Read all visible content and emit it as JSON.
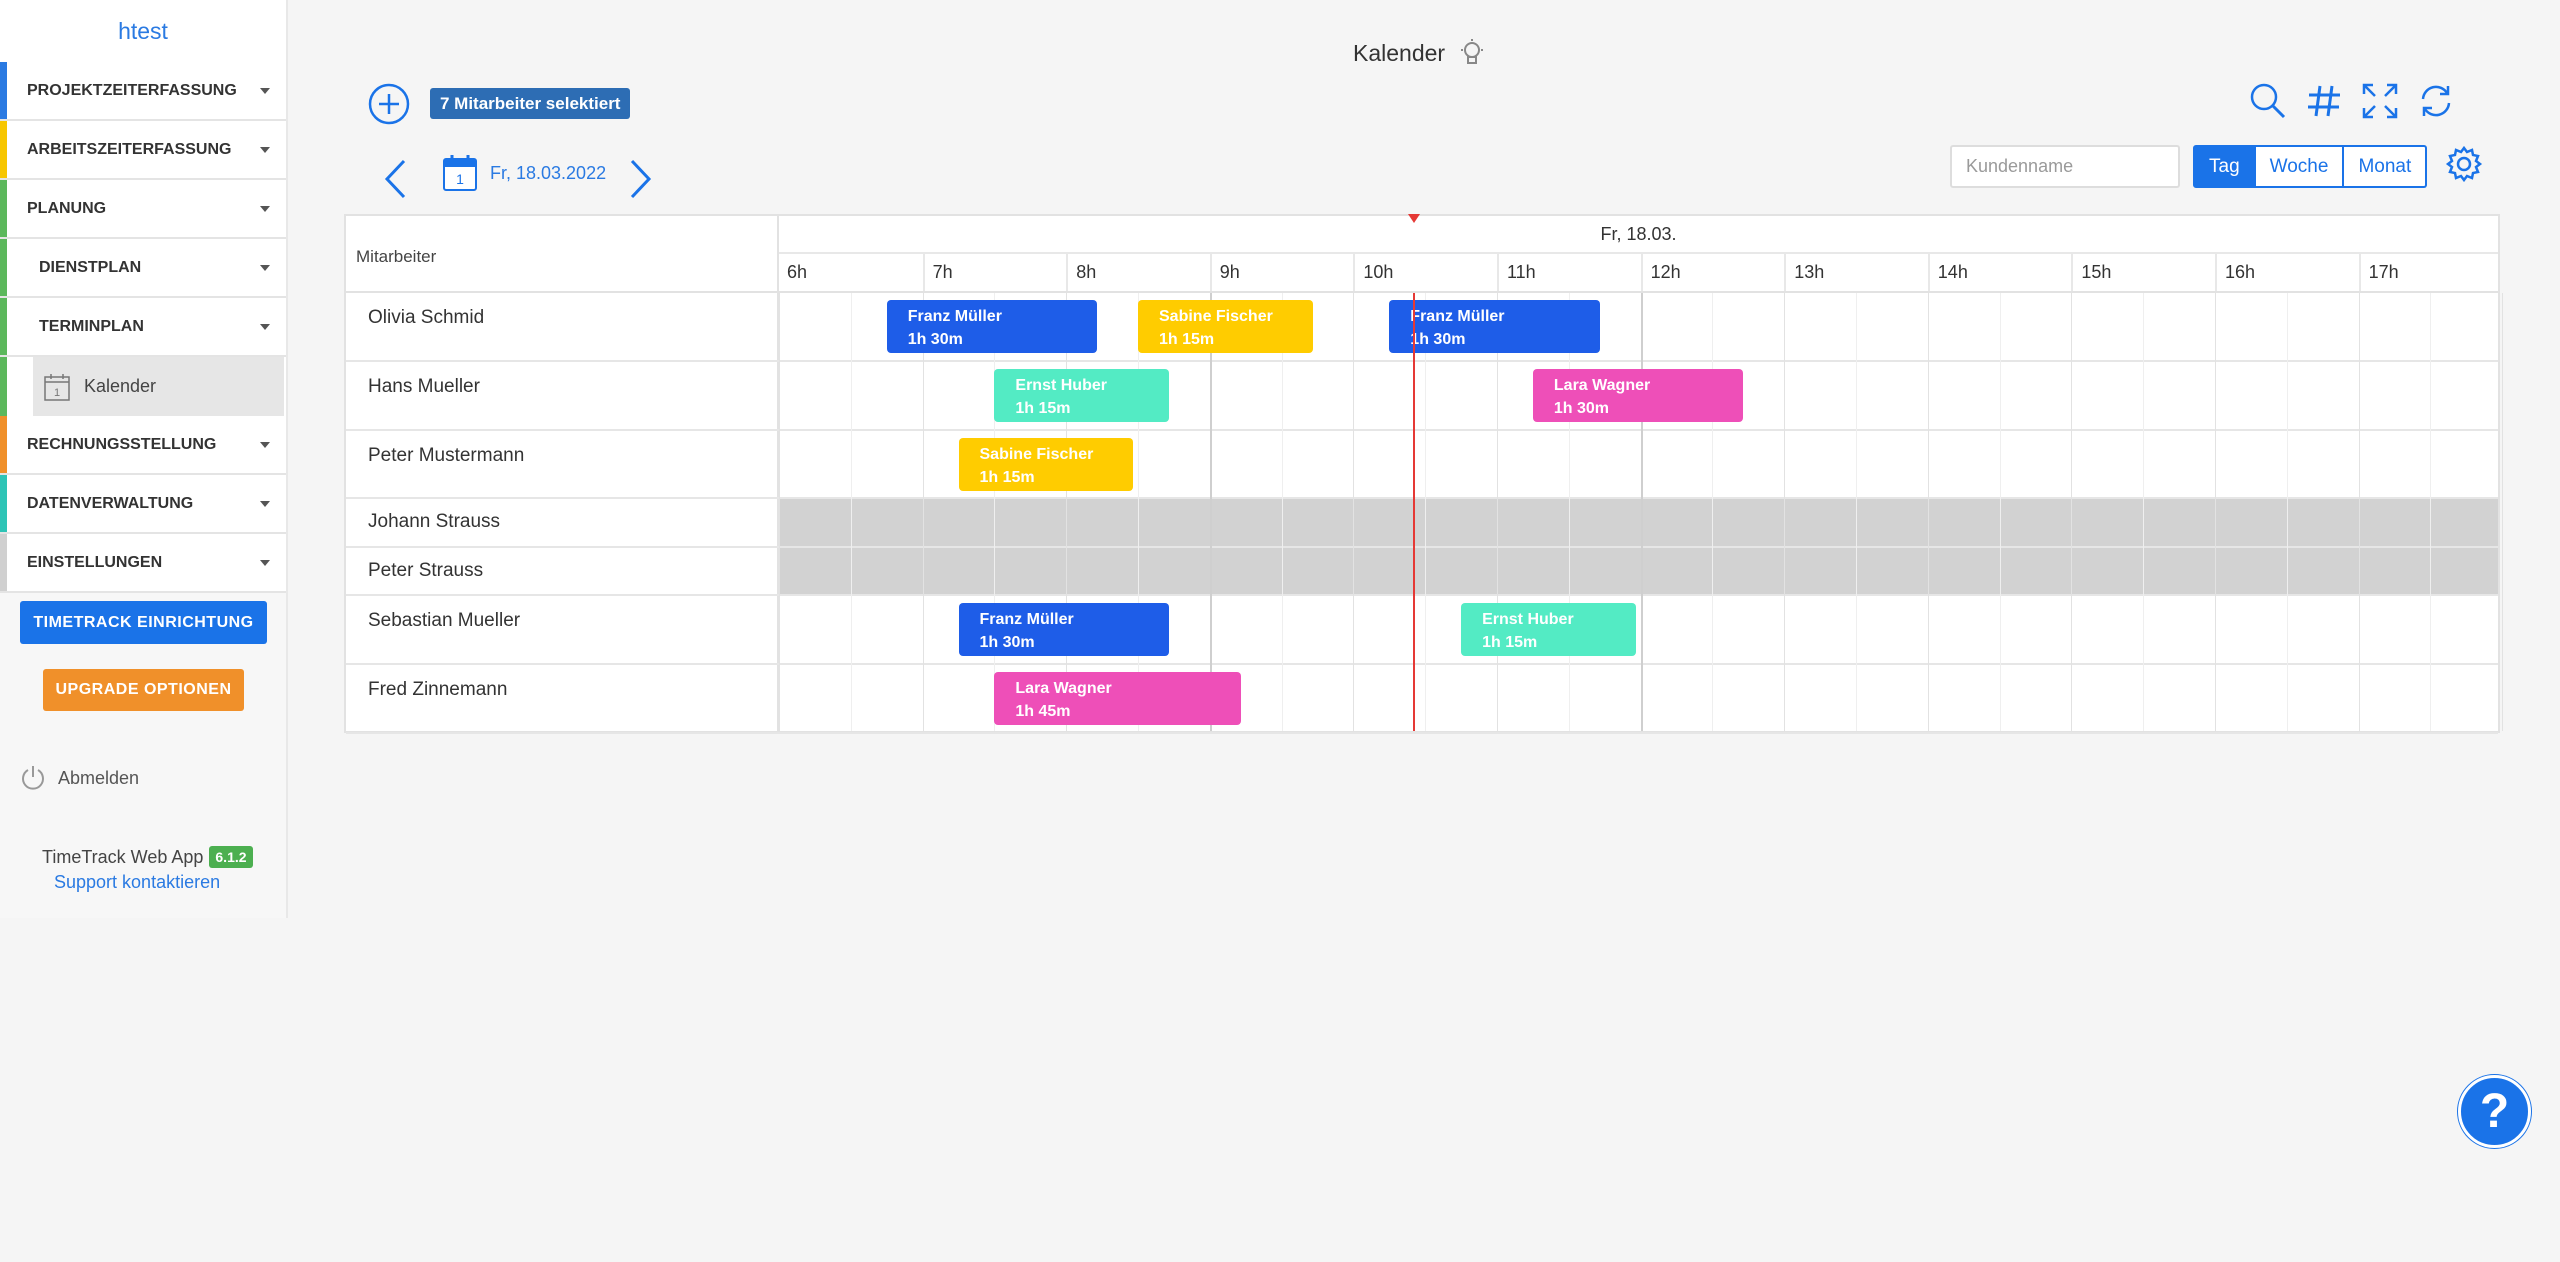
{
  "sidebar": {
    "brand": "htest",
    "items": [
      {
        "label": "PROJEKTZEITERFASSUNG",
        "color": "#2a7ae2"
      },
      {
        "label": "ARBEITSZEITERFASSUNG",
        "color": "#f7c600"
      },
      {
        "label": "PLANUNG",
        "color": "#5cb85c"
      },
      {
        "label": "DIENSTPLAN",
        "color": "#5cb85c"
      },
      {
        "label": "TERMINPLAN",
        "color": "#5cb85c"
      },
      {
        "label": "Kalender",
        "color": "#5cb85c"
      },
      {
        "label": "RECHNUNGSSTELLUNG",
        "color": "#f0902a"
      },
      {
        "label": "DATENVERWALTUNG",
        "color": "#2ec4b6"
      },
      {
        "label": "EINSTELLUNGEN",
        "color": "#d0d0d0"
      }
    ],
    "setup_button": "TIMETRACK EINRICHTUNG",
    "upgrade_button": "UPGRADE OPTIONEN",
    "logout": "Abmelden",
    "app_name": "TimeTrack Web App",
    "version": "6.1.2",
    "support": "Support kontaktieren"
  },
  "header": {
    "title": "Kalender",
    "selected_badge": "7 Mitarbeiter selektiert",
    "date": "Fr, 18.03.2022",
    "date_icon_day": "1",
    "customer_placeholder": "Kundenname",
    "views": [
      "Tag",
      "Woche",
      "Monat"
    ],
    "active_view": "Tag"
  },
  "calendar": {
    "resource_header": "Mitarbeiter",
    "day_label": "Fr, 18.03.",
    "hours": [
      "6h",
      "7h",
      "8h",
      "9h",
      "10h",
      "11h",
      "12h",
      "13h",
      "14h",
      "15h",
      "16h",
      "17h"
    ],
    "now_time": "10:25",
    "rows": [
      {
        "name": "Olivia Schmid",
        "disabled": false,
        "events": [
          {
            "who": "Franz Müller",
            "duration": "1h 30m",
            "start": "6:45",
            "color": "#1e5de8"
          },
          {
            "who": "Sabine Fischer",
            "duration": "1h 15m",
            "start": "8:30",
            "color": "#ffcc00"
          },
          {
            "who": "Franz Müller",
            "duration": "1h 30m",
            "start": "10:15",
            "color": "#1e5de8"
          }
        ]
      },
      {
        "name": "Hans Mueller",
        "disabled": false,
        "events": [
          {
            "who": "Ernst Huber",
            "duration": "1h 15m",
            "start": "7:30",
            "color": "#53ebc4"
          },
          {
            "who": "Lara Wagner",
            "duration": "1h 30m",
            "start": "11:15",
            "color": "#ee4fb8"
          }
        ]
      },
      {
        "name": "Peter Mustermann",
        "disabled": false,
        "events": [
          {
            "who": "Sabine Fischer",
            "duration": "1h 15m",
            "start": "7:15",
            "color": "#ffcc00"
          }
        ]
      },
      {
        "name": "Johann Strauss",
        "disabled": true,
        "events": []
      },
      {
        "name": "Peter Strauss",
        "disabled": true,
        "events": []
      },
      {
        "name": "Sebastian Mueller",
        "disabled": false,
        "events": [
          {
            "who": "Franz Müller",
            "duration": "1h 30m",
            "start": "7:15",
            "color": "#1e5de8"
          },
          {
            "who": "Ernst Huber",
            "duration": "1h 15m",
            "start": "10:45",
            "color": "#53ebc4"
          }
        ]
      },
      {
        "name": "Fred Zinnemann",
        "disabled": false,
        "events": [
          {
            "who": "Lara Wagner",
            "duration": "1h 45m",
            "start": "7:30",
            "color": "#ee4fb8"
          }
        ]
      }
    ]
  },
  "help_label": "?"
}
